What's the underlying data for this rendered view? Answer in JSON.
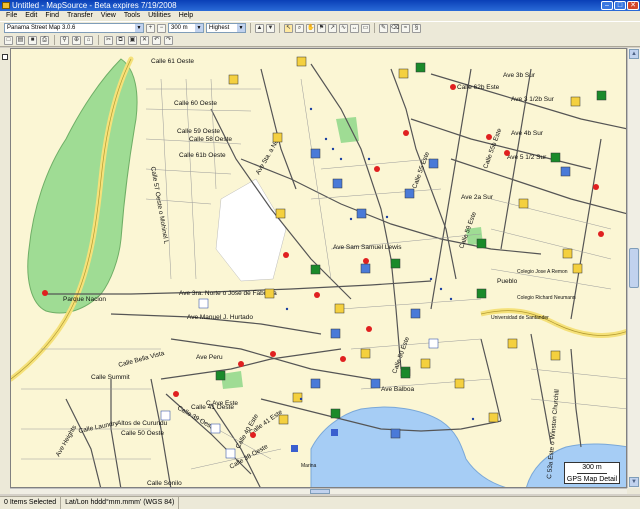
{
  "window": {
    "title": "Untitled - MapSource - Beta expires 7/19/2008"
  },
  "menu": [
    "File",
    "Edit",
    "Find",
    "Transfer",
    "View",
    "Tools",
    "Utilities",
    "Help"
  ],
  "toolbar": {
    "product": "Panama Street Map 3.0.6",
    "zoom": "300 m",
    "detail": "Highest"
  },
  "map": {
    "labels": {
      "calle_61_oeste": "Calle 61 Oeste",
      "calle_60_oeste": "Calle 60 Oeste",
      "calle_59_oeste": "Calle 59 Oeste",
      "calle_58_oeste": "Calle 58 Oeste",
      "calle_61b_oeste": "Calle 61b Oeste",
      "calle_57_oeste": "Calle 57 Oeste o Mohinel L",
      "parque_nacional": "Parque Nacion",
      "ave_3ra_norte": "Ave 3ra. Norte o Jose de Fabrega",
      "ave_manuel_hurtado": "Ave Manuel J. Hurtado",
      "calle_bella_vista": "Calle Bella Vista",
      "calle_summit": "Calle Summit",
      "altos_de_curundu": "Altos de Curundu",
      "calle_laundry": "Calle Laundry",
      "calle_50_oeste": "Calle 50 Oeste",
      "ave_heights": "Ave Heights",
      "calle_39_oeste": "Calle 39 Oeste",
      "calle_41_oeste": "Calle 41 Oeste",
      "calle_38_oeste": "Calle 38 Oeste",
      "ave_balboa": "Ave Balboa",
      "ave_peru": "Ave Peru",
      "ave_5ta_a_norte": "Ave 5ta. a Norte",
      "ave_san_lewis": "Ave Sam Samuel Lewis",
      "ave_3b_sur": "Ave 3b Sur",
      "ave_3_1_2b_sur": "Ave 3 1/2b Sur",
      "ave_4b_sur": "Ave 4b Sur",
      "ave_5_1_2_sur": "Ave 5 1/2 Sur",
      "calle_62b_este": "Calle 62b Este",
      "calle_50_este": "Calle 50 Este",
      "calle_55_este": "Calle 55 Este",
      "calle_59_este": "Calle 59 Este",
      "calle_55b_este": "Calle 55b Este",
      "calle_53_este": "C 53a Este o Winston Churchill",
      "calle_41_este": "Calle 41 Este",
      "calle_40_este": "Calle 40 Este",
      "c_ave_este": "C Ave Este",
      "ave_2a_sur": "Ave 2a Sur",
      "colegio_panama": "Colegio Jose A Remon",
      "colegio_richard": "Colegio Richard Neumann",
      "costa_del_este": "Universidad de Santander",
      "pueblo": "Pueblo",
      "marina": "Marina",
      "calle_sonilo": "Calle Sonilo"
    },
    "scale": "300 m",
    "detail_label": "GPS Map Detail"
  },
  "status": {
    "items_selected": "0 Items Selected",
    "coord_format": "Lat/Lon hddd°mm.mmm' (WGS 84)"
  },
  "colors": {
    "land": "#fbf6d4",
    "park": "#9fdc94",
    "water": "#a6cdf5",
    "major_road": "#f5e17a",
    "road": "#555555",
    "poi_red": "#e02020"
  }
}
